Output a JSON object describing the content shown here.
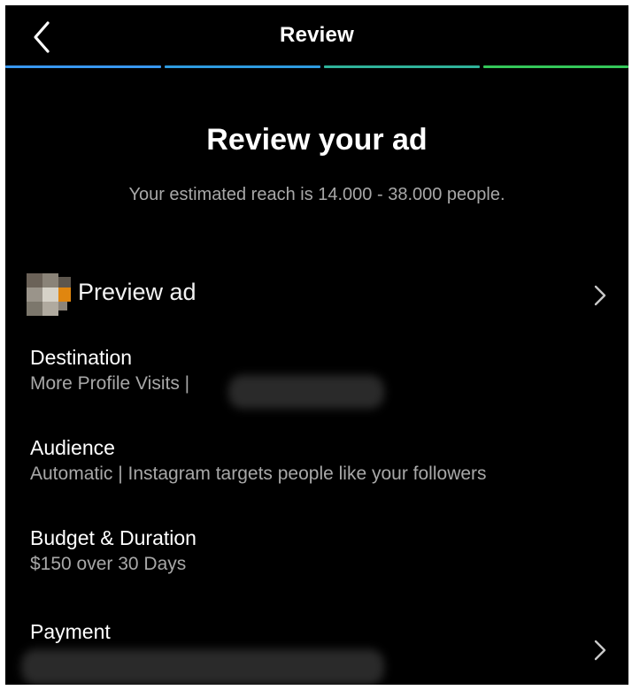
{
  "nav": {
    "title": "Review",
    "back_icon": "chevron-left-icon",
    "progress_colors": [
      "#3897f0",
      "#2e9be0",
      "#2fb39a",
      "#34c759"
    ]
  },
  "main": {
    "headline": "Review your ad",
    "reach_text": "Your estimated reach is 14.000 - 38.000 people."
  },
  "preview": {
    "label": "Preview ad",
    "chevron_icon": "chevron-right-icon"
  },
  "sections": {
    "destination": {
      "title": "Destination",
      "value": "More Profile Visits |"
    },
    "audience": {
      "title": "Audience",
      "value": "Automatic | Instagram targets people like your followers"
    },
    "budget": {
      "title": "Budget & Duration",
      "value": "$150 over 30 Days"
    },
    "payment": {
      "title": "Payment",
      "chevron_icon": "chevron-right-icon"
    }
  }
}
